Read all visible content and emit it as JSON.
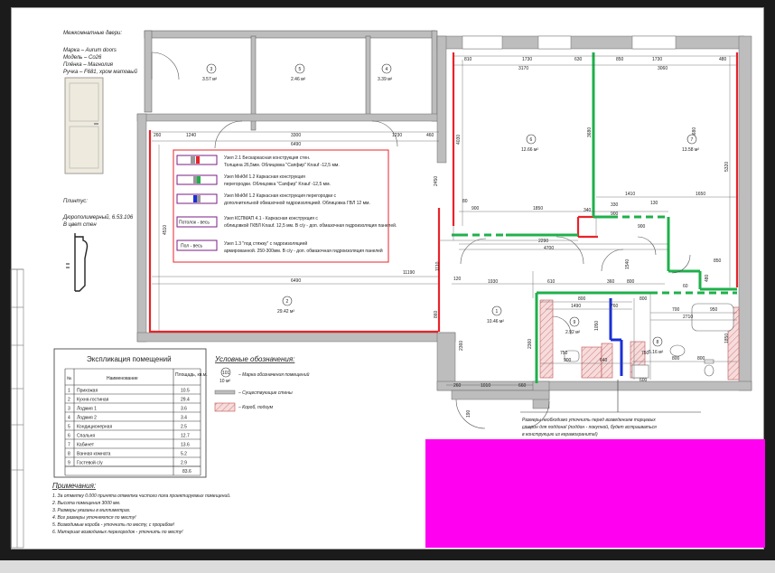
{
  "doors": {
    "heading": "Межкомнатные двери:",
    "lines": [
      "Марка – Aurum doors",
      "Модель – Co26",
      "Плёнка – Магнолия",
      "Ручка – F681, хром матовый"
    ]
  },
  "plinth": {
    "heading": "Плинтус:",
    "lines": [
      "Дюрополимерный, 6.53.106",
      "В цвет стен"
    ]
  },
  "legend_nodes": [
    {
      "code": "",
      "line1": "Узел 2.1 Бескаркасная конструкция стен.",
      "line2": "Толщина 26,5мм. Облицовка \"Сапфир\" Knauf -12,5 мм."
    },
    {
      "code": "",
      "line1": "Узел МнКМ 1.2 Каркасная конструкция",
      "line2": "перегородки. Облицовка \"Сапфир\" Knauf -12,5 мм."
    },
    {
      "code": "",
      "line1": "Узел МнКМ 1.2 Каркасная конструкция перегородки с",
      "line2": "дополнительной обмазочной гидроизоляцией. Облицовка ГВЛ 12 мм."
    },
    {
      "code": "Потолок - весь",
      "line1": "Узел КСПМАП 4.1 - Каркасная конструкция с",
      "line2": "облицовкой ГКВЛ Knauf. 12,5 мм. В с/у - доп. обмазочная гидроизоляция панелей."
    },
    {
      "code": "Пол - весь",
      "line1": "Узел 1.3 \"под стяжку\" с гидроизоляцией",
      "line2": "армированной. 250-300мм. В с/у - доп. обмазочная гидроизоляция панелей"
    }
  ],
  "symbols": {
    "heading": "Условные обозначения:",
    "marker_top": "101",
    "marker_bottom": "10 м²",
    "marker_label": "– Марка обозначения помещений",
    "walls_label": "– Существующие стены",
    "box_label": "– Короб, подиум"
  },
  "explication": {
    "title": "Экспликация помещений",
    "headers": [
      "№",
      "Наименование",
      "Площадь, кв.м."
    ],
    "rows": [
      [
        "1",
        "Прихожая",
        "10.5"
      ],
      [
        "2",
        "Кухня-гостиная",
        "29.4"
      ],
      [
        "3",
        "Лоджия 1",
        "3.6"
      ],
      [
        "4",
        "Лоджия 2",
        "3.4"
      ],
      [
        "5",
        "Кондиционерная",
        "2.5"
      ],
      [
        "6",
        "Спальня",
        "12.7"
      ],
      [
        "7",
        "Кабинет",
        "13.6"
      ],
      [
        "8",
        "Ванная комната",
        "5.2"
      ],
      [
        "9",
        "Гостевой с/у",
        "2.9"
      ]
    ],
    "total": "83.6"
  },
  "notes": {
    "heading": "Примечания:",
    "items": [
      "1.   За отметку 0.000 принята отметка чистого пола проектируемых помещений.",
      "2.   Высота помещения 3000 мм.",
      "3.   Размеры указаны в миллиметрах.",
      "4.   Все размеры уточняются по месту!",
      "5.   Возводимые короба - уточнить по месту, с прорабом!",
      "6.   Материал возводимых перегородок - уточнить по месту!"
    ]
  },
  "callout": {
    "lines": [
      "Размеры необходимо уточнить перед возведением торцевых",
      "сторон для поддона! (поддон - покупной, будет встраиваться",
      "в конструкцию из керамогранита!)"
    ]
  },
  "rooms": [
    {
      "num": "3",
      "area": "3.57 м²"
    },
    {
      "num": "5",
      "area": "2.46 м²"
    },
    {
      "num": "4",
      "area": "3.39 м²"
    },
    {
      "num": "6",
      "area": "12.66 м²"
    },
    {
      "num": "7",
      "area": "13.58 м²"
    },
    {
      "num": "2",
      "area": "29.42 м²"
    },
    {
      "num": "1",
      "area": "10.46 м²"
    },
    {
      "num": "9",
      "area": "2.92 м²"
    },
    {
      "num": "8",
      "area": "5.16 м²"
    }
  ],
  "dims": {
    "d810": "810",
    "d1730a": "1730",
    "d630": "630",
    "d850": "850",
    "d1730b": "1730",
    "d480a": "480",
    "d3170": "3170",
    "d3060": "3060",
    "d260a": "260",
    "d1240": "1240",
    "d3300": "3300",
    "d1230": "1230",
    "d460": "460",
    "d6490a": "6490",
    "d4030": "4030",
    "d3680a": "3680",
    "d3680b": "3680",
    "d5320": "5320",
    "d1410": "1410",
    "d1650": "1650",
    "d330": "330",
    "d130": "130",
    "d340": "340",
    "d900a": "900",
    "d1850": "1850",
    "d900b": "900",
    "d900c": "900",
    "d2290": "2290",
    "d4700": "4700",
    "d2450": "2450",
    "d4510": "4510",
    "d11190": "11190",
    "d1110": "1110",
    "d6490b": "6490",
    "d120": "120",
    "d1930": "1930",
    "d610": "610",
    "d360": "360",
    "d800a": "800",
    "d850b": "850",
    "d480b": "480",
    "d1540": "1540",
    "d800b": "800",
    "d800c": "800",
    "d60": "60",
    "d1490": "1490",
    "d760": "760",
    "d700": "700",
    "d950": "950",
    "d2710": "2710",
    "d1050": "1050",
    "d750a": "750",
    "d750b": "750",
    "d800d": "800",
    "d900d": "900",
    "d640": "640",
    "d800e": "800",
    "d600": "600",
    "d1850b": "1850",
    "d860": "860",
    "d2360a": "2360",
    "d2360b": "2360",
    "d260b": "260",
    "d1010": "1010",
    "d660": "660",
    "d190": "190",
    "d80": "80"
  }
}
